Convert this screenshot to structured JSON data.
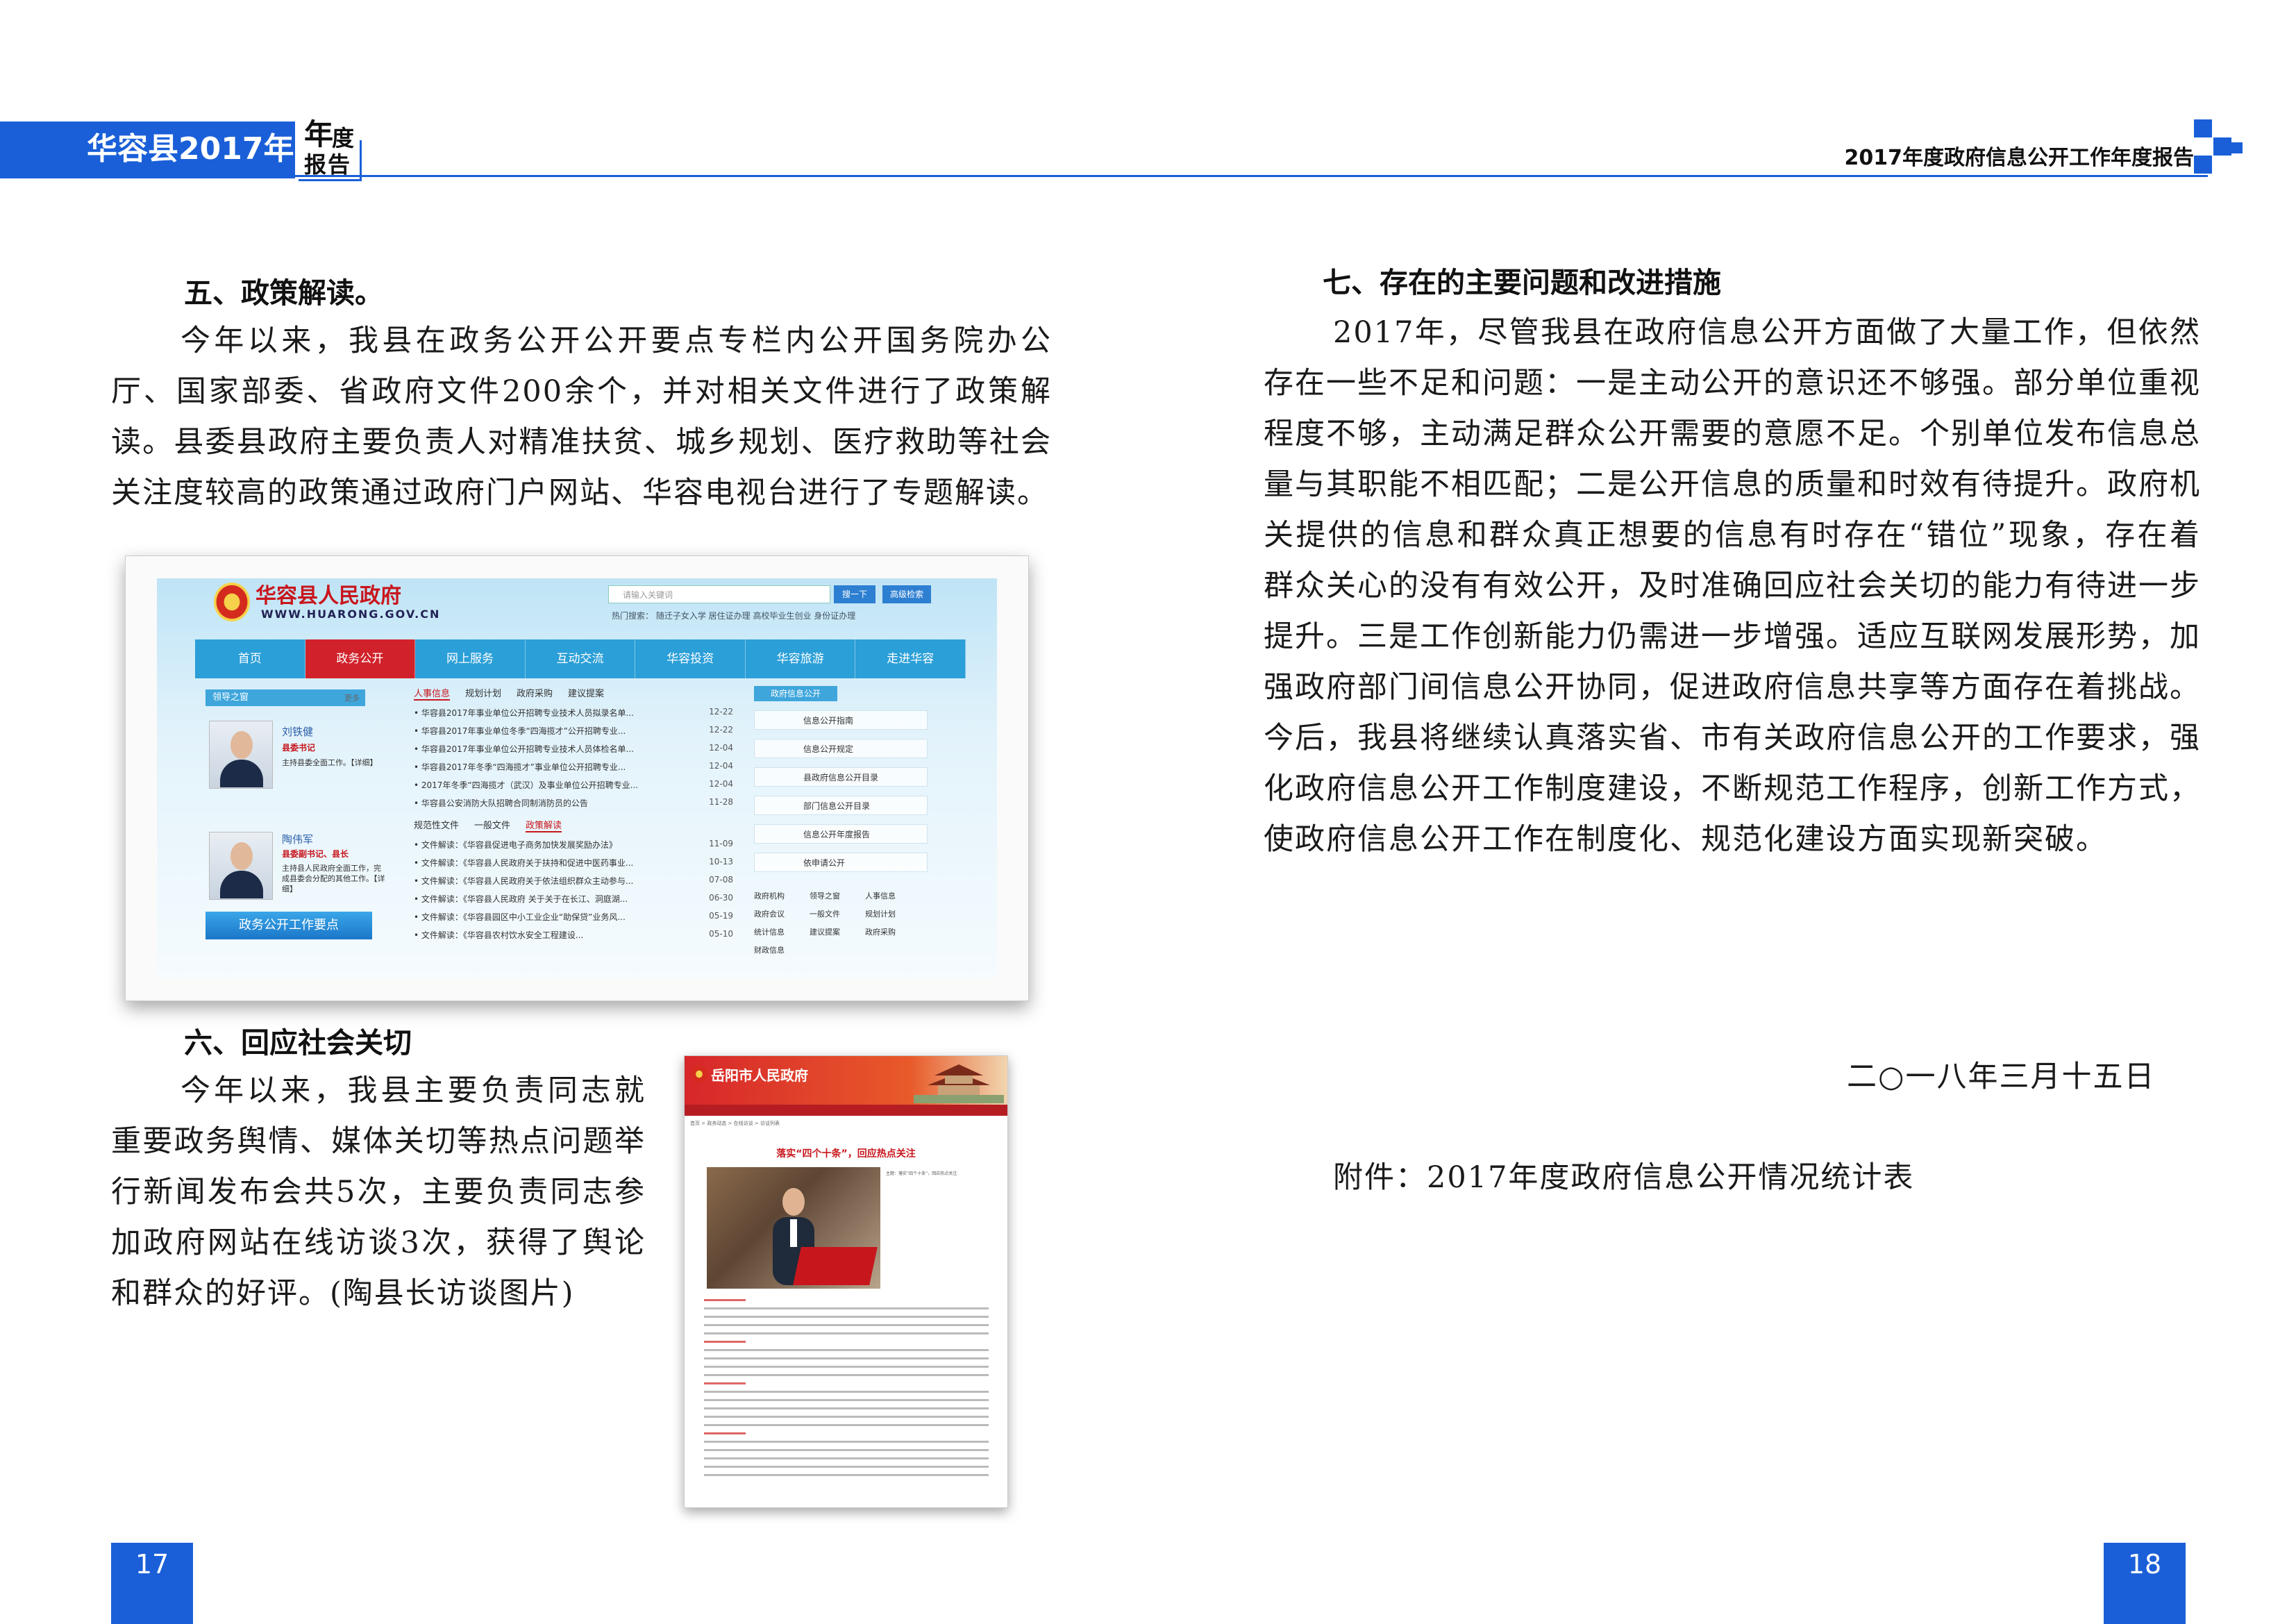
{
  "header": {
    "left_title": "华容县2017年",
    "badge_char1": "年",
    "badge_char2": "度",
    "badge_char3": "报告",
    "right_title": "2017年度政府信息公开工作年度报告"
  },
  "sections": {
    "s5": {
      "title": "五、政策解读。",
      "body": "今年以来，我县在政务公开公开要点专栏内公开国务院办公厅、国家部委、省政府文件200余个，并对相关文件进行了政策解读。县委县政府主要负责人对精准扶贫、城乡规划、医疗救助等社会关注度较高的政策通过政府门户网站、华容电视台进行了专题解读。"
    },
    "s6": {
      "title": "六、回应社会关切",
      "body": "今年以来，我县主要负责同志就重要政务舆情、媒体关切等热点问题举行新闻发布会共5次，主要负责同志参加政府网站在线访谈3次，获得了舆论和群众的好评。(陶县长访谈图片)"
    },
    "s7": {
      "title": "七、存在的主要问题和改进措施",
      "body": "2017年，尽管我县在政府信息公开方面做了大量工作，但依然存在一些不足和问题：一是主动公开的意识还不够强。部分单位重视程度不够，主动满足群众公开需要的意愿不足。个别单位发布信息总量与其职能不相匹配；二是公开信息的质量和时效有待提升。政府机关提供的信息和群众真正想要的信息有时存在“错位”现象，存在着群众关心的没有有效公开，及时准确回应社会关切的能力有待进一步提升。三是工作创新能力仍需进一步增强。适应互联网发展形势，加强政府部门间信息公开协同，促进政府信息共享等方面存在着挑战。今后，我县将继续认真落实省、市有关政府信息公开的工作要求，强化政府信息公开工作制度建设，不断规范工作程序，创新工作方式，使政府信息公开工作在制度化、规范化建设方面实现新突破。"
    }
  },
  "date": "二○一八年三月十五日",
  "attachment": "附件：2017年度政府信息公开情况统计表",
  "page_numbers": {
    "left": "17",
    "right": "18"
  },
  "screenshot1": {
    "site_name": "华容县人民政府",
    "url": "WWW.HUARONG.GOV.CN",
    "search_placeholder": "请输入关键词",
    "search_btn": "搜一下",
    "adv_btn": "高级检索",
    "hot": "热门搜索：   随迁子女入学   居住证办理   高校毕业生创业   身份证办理",
    "nav": [
      "首页",
      "政务公开",
      "网上服务",
      "互动交流",
      "华容投资",
      "华容旅游",
      "走进华容"
    ],
    "leaders_header": "领导之窗",
    "leaders_more": "更多",
    "leader1": {
      "name": "刘铁健",
      "role": "县委书记",
      "desc": "主持县委全面工作。【详细】"
    },
    "leader2": {
      "name": "陶伟军",
      "role": "县委副书记、县长",
      "desc": "主持县人民政府全面工作，完成县委会分配的其他工作。【详细】"
    },
    "big_btn": "政务公开工作要点",
    "tabs1": [
      "人事信息",
      "规划计划",
      "政府采购",
      "建议提案"
    ],
    "news1": [
      {
        "t": "华容县2017年事业单位公开招聘专业技术人员拟录名单...",
        "d": "12-22"
      },
      {
        "t": "华容县2017年事业单位冬季“四海揽才”公开招聘专业...",
        "d": "12-22"
      },
      {
        "t": "华容县2017年事业单位公开招聘专业技术人员体检名单...",
        "d": "12-04"
      },
      {
        "t": "华容县2017年冬季“四海揽才”事业单位公开招聘专业...",
        "d": "12-04"
      },
      {
        "t": "2017年冬季“四海揽才（武汉）及事业单位公开招聘专业...",
        "d": "12-04"
      },
      {
        "t": "华容县公安消防大队招聘合同制消防员的公告",
        "d": "11-28"
      }
    ],
    "tabs2": [
      "规范性文件",
      "一般文件",
      "政策解读"
    ],
    "news2": [
      {
        "t": "文件解读：《华容县促进电子商务加快发展奖励办法》",
        "d": "11-09"
      },
      {
        "t": "文件解读：《华容县人民政府关于扶持和促进中医药事业...",
        "d": "10-13"
      },
      {
        "t": "文件解读：《华容县人民政府关于依法组织群众主动参与...",
        "d": "07-08"
      },
      {
        "t": "文件解读：《华容县人民政府 关于关于在长江、洞庭湖...",
        "d": "06-30"
      },
      {
        "t": "文件解读：《华容县园区中小工业企业“助保贷”业务风...",
        "d": "05-19"
      },
      {
        "t": "文件解读：《华容县农村饮水安全工程建设...",
        "d": "05-10"
      }
    ],
    "right_header": "政府信息公开",
    "right_items": [
      "信息公开指南",
      "信息公开规定",
      "县政府信息公开目录",
      "部门信息公开目录",
      "信息公开年度报告",
      "依申请公开"
    ],
    "grid": [
      "政府机构",
      "领导之窗",
      "人事信息",
      "政府会议",
      "一般文件",
      "规划计划",
      "统计信息",
      "建议提案",
      "政府采购",
      "财政信息"
    ]
  },
  "screenshot2": {
    "site_name": "岳阳市人民政府",
    "crumb": "首页 > 政务动态 > 在线访谈 > 访谈列表",
    "headline": "落实“四个十条”，回应热点关注",
    "side_title": "主题：落实“四个十条”，回应热点关注"
  },
  "colors": {
    "accent": "#1a5fd8",
    "site_red": "#c8161d",
    "nav_blue": "#2b9fd8"
  }
}
